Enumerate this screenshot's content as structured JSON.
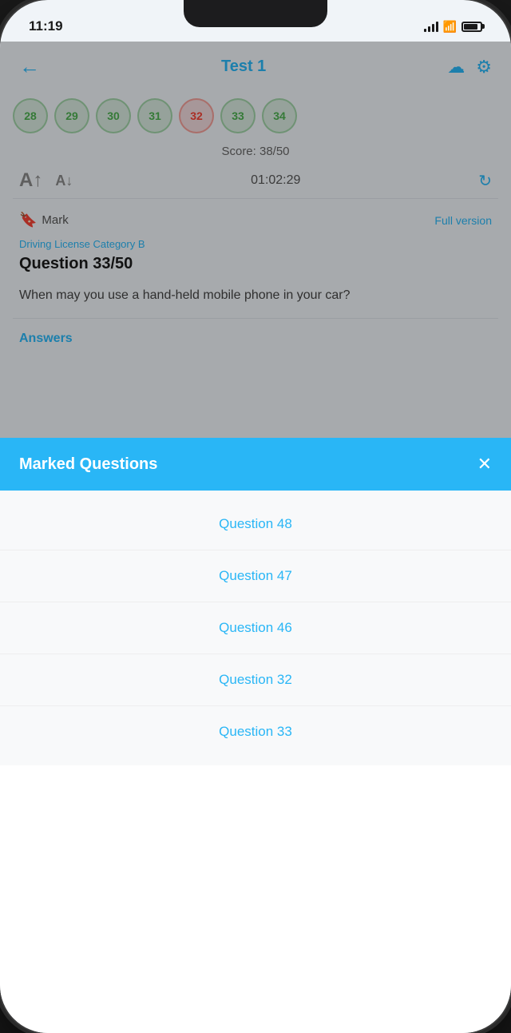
{
  "status_bar": {
    "time": "11:19",
    "battery_label": "battery"
  },
  "header": {
    "back_label": "‹",
    "title": "Test 1",
    "cloud_icon": "☁",
    "settings_icon": "⚙"
  },
  "question_numbers": [
    {
      "number": "28",
      "state": "green"
    },
    {
      "number": "29",
      "state": "green"
    },
    {
      "number": "30",
      "state": "green"
    },
    {
      "number": "31",
      "state": "green"
    },
    {
      "number": "32",
      "state": "red"
    },
    {
      "number": "33",
      "state": "green"
    },
    {
      "number": "34",
      "state": "green"
    }
  ],
  "score": {
    "label": "Score: 38/50"
  },
  "controls": {
    "font_large": "A↑",
    "font_small": "A↓",
    "timer": "01:02:29",
    "refresh_icon": "↻"
  },
  "question_card": {
    "mark_label": "Mark",
    "full_version_label": "Full version",
    "category": "Driving License Category B",
    "question_title": "Question 33/50",
    "question_text": "When may you use a hand-held mobile phone in your car?"
  },
  "answers_section": {
    "label": "Answers"
  },
  "modal": {
    "title": "Marked Questions",
    "close_label": "✕",
    "items": [
      {
        "label": "Question 48"
      },
      {
        "label": "Question 47"
      },
      {
        "label": "Question 46"
      },
      {
        "label": "Question 32"
      },
      {
        "label": "Question 33"
      }
    ]
  },
  "colors": {
    "accent": "#29b6f6",
    "green": "#4caf50",
    "red": "#f44336"
  }
}
